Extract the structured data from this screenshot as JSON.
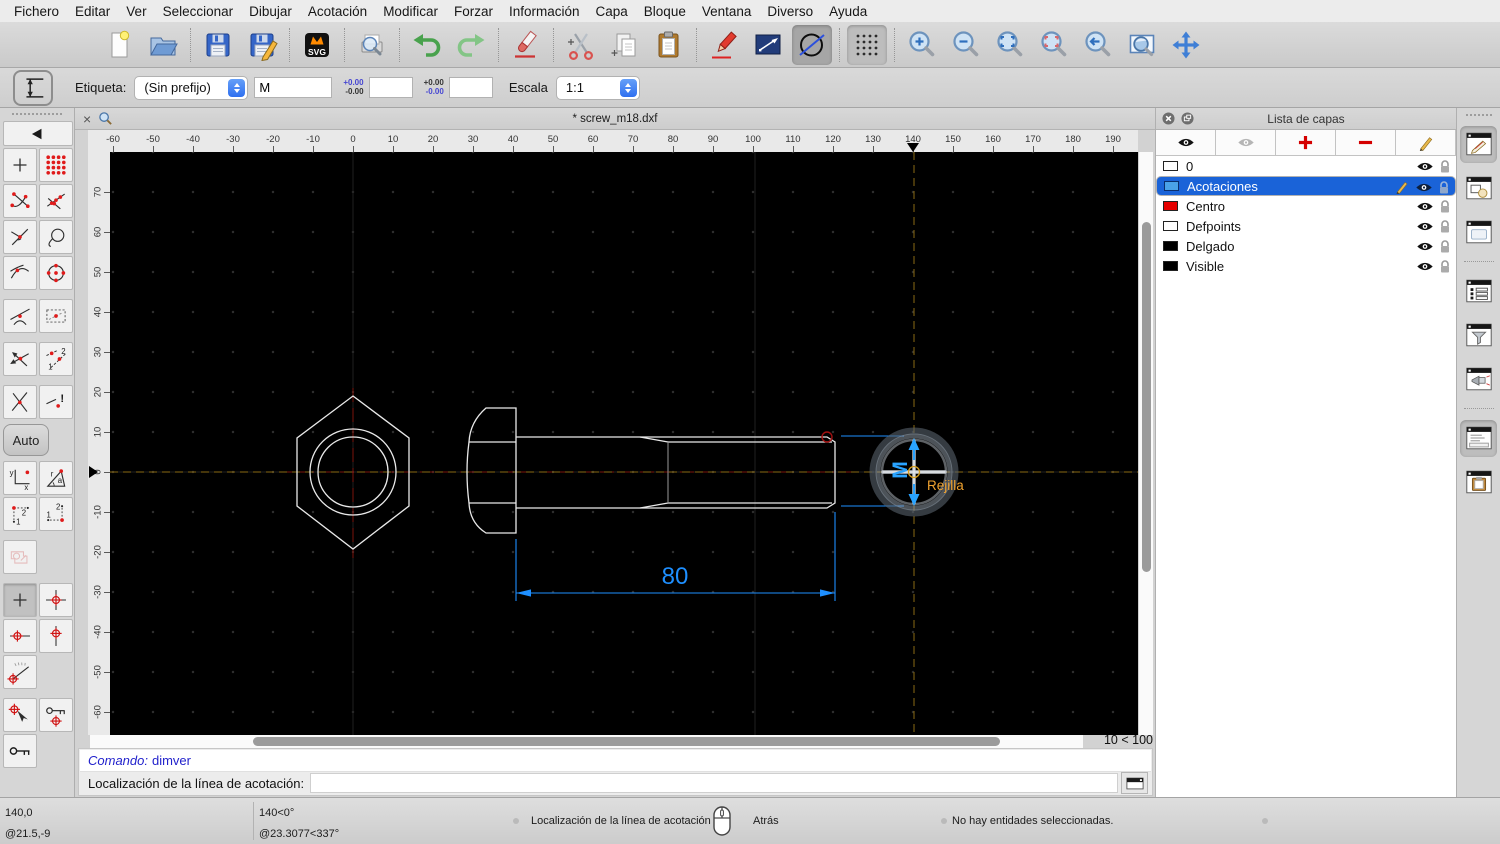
{
  "colors": {
    "selection_blue": "#1a63d8",
    "dimension_blue": "#1e8fff",
    "preview_blue": "#29a3ff",
    "snap_orange": "#f0a22e",
    "centerline_red": "#7d140c",
    "crosshair_gold": "#8a6a14",
    "canvas_black": "#000000"
  },
  "menu_bar": {
    "items": [
      "Fichero",
      "Editar",
      "Ver",
      "Seleccionar",
      "Dibujar",
      "Acotación",
      "Modificar",
      "Forzar",
      "Información",
      "Capa",
      "Bloque",
      "Ventana",
      "Diverso",
      "Ayuda"
    ]
  },
  "main_toolbar": {
    "buttons": [
      {
        "name": "new-document"
      },
      {
        "name": "open-file"
      },
      {
        "separator": true
      },
      {
        "name": "save"
      },
      {
        "name": "save-as"
      },
      {
        "separator": true
      },
      {
        "name": "svg-export"
      },
      {
        "separator": true
      },
      {
        "name": "print-preview"
      },
      {
        "separator": true
      },
      {
        "name": "undo"
      },
      {
        "name": "redo"
      },
      {
        "separator": true
      },
      {
        "name": "delete"
      },
      {
        "separator": true
      },
      {
        "name": "cut"
      },
      {
        "name": "copy"
      },
      {
        "name": "paste"
      },
      {
        "separator": true
      },
      {
        "name": "draw-pencil"
      },
      {
        "name": "polyline-tool"
      },
      {
        "name": "circle-tool",
        "pressed": true,
        "dark": true
      },
      {
        "separator": true
      },
      {
        "name": "grid-toggle",
        "pressed": true
      },
      {
        "separator": true
      },
      {
        "name": "zoom-in"
      },
      {
        "name": "zoom-out"
      },
      {
        "name": "zoom-auto"
      },
      {
        "name": "zoom-selection"
      },
      {
        "name": "zoom-previous"
      },
      {
        "name": "zoom-window"
      },
      {
        "name": "pan"
      }
    ]
  },
  "options_toolbar": {
    "active_tool_icon": "vertical-dimension-icon",
    "label_caption": "Etiqueta:",
    "prefix_value": "(Sin prefijo)",
    "label_value": "M",
    "tolerance_upper": {
      "plus": "+0.00",
      "minus": "-0.00"
    },
    "tolerance_lower": {
      "plus": "+0.00",
      "minus": "-0.00"
    },
    "tolerance_upper_value": "",
    "tolerance_lower_value": "",
    "scale_caption": "Escala",
    "scale_value": "1:1"
  },
  "snap_sidebar": {
    "auto_label": "Auto",
    "rows": [
      {
        "type": "wide",
        "icon": "back-arrow",
        "name": "snap-back"
      },
      {
        "type": "pair",
        "icons": [
          "free-snap",
          "grid-snap"
        ]
      },
      {
        "type": "pair",
        "icons": [
          "endpoint-snap",
          "on-entity-snap"
        ]
      },
      {
        "type": "pair",
        "icons": [
          "perpendicular-snap",
          "reference-snap"
        ]
      },
      {
        "type": "pair",
        "icons": [
          "nearest-snap",
          "center-snap"
        ]
      },
      {
        "type": "gap"
      },
      {
        "type": "pair",
        "icons": [
          "tangent-snap",
          "middle-snap"
        ]
      },
      {
        "type": "gap"
      },
      {
        "type": "pair",
        "icons": [
          "intersection-auto-snap",
          "intersection-manual-snap"
        ]
      },
      {
        "type": "gap"
      },
      {
        "type": "pair",
        "icons": [
          "intersection-snap",
          "restriction-info"
        ]
      },
      {
        "type": "auto"
      },
      {
        "type": "pair",
        "icons": [
          "coordinate-cartesian",
          "coordinate-polar"
        ]
      },
      {
        "type": "pair",
        "icons": [
          "corner-point-12",
          "corner-point-21"
        ]
      },
      {
        "type": "gap"
      },
      {
        "type": "single",
        "icons": [
          "selection-tool-faded"
        ]
      },
      {
        "type": "gap"
      },
      {
        "type": "pair",
        "icons": [
          "restrict-nothing",
          "restrict-orthogonal"
        ],
        "pressed": [
          0
        ]
      },
      {
        "type": "pair",
        "icons": [
          "restrict-horizontal",
          "restrict-vertical"
        ]
      },
      {
        "type": "single",
        "icons": [
          "angle-meter"
        ]
      },
      {
        "type": "gap"
      },
      {
        "type": "pair",
        "icons": [
          "set-relative-zero",
          "lock-relative-zero"
        ]
      },
      {
        "type": "single",
        "icons": [
          "key-lock"
        ]
      }
    ]
  },
  "document": {
    "title": "* screw_m18.dxf",
    "h_ruler": {
      "min": -60,
      "max": 190,
      "step": 10,
      "marker": 140
    },
    "v_ruler": {
      "min": -60,
      "max": 70,
      "step": 10,
      "marker": 0
    },
    "grid_status": "10 < 100",
    "entities": {
      "dimension_label": "80",
      "preview_dimension_label": "M",
      "snap_tooltip": "Rejilla"
    }
  },
  "layer_panel": {
    "title": "Lista de capas",
    "toolbar": [
      {
        "name": "show-all-layers",
        "icon": "eye"
      },
      {
        "name": "hide-all-layers",
        "icon": "eye-gray"
      },
      {
        "name": "add-layer",
        "icon": "plus-red"
      },
      {
        "name": "remove-layer",
        "icon": "minus-red"
      },
      {
        "name": "edit-layer",
        "icon": "pencil"
      }
    ],
    "layers": [
      {
        "name": "0",
        "swatch": "#ffffff",
        "selected": false
      },
      {
        "name": "Acotaciones",
        "swatch": "#4aa2e8",
        "selected": true
      },
      {
        "name": "Centro",
        "swatch": "#e60000",
        "selected": false
      },
      {
        "name": "Defpoints",
        "swatch": "#ffffff",
        "selected": false
      },
      {
        "name": "Delgado",
        "swatch": "#000000",
        "selected": false
      },
      {
        "name": "Visible",
        "swatch": "#000000",
        "selected": false
      }
    ]
  },
  "right_dock": {
    "buttons": [
      {
        "name": "layer-list-panel",
        "active": true
      },
      {
        "name": "block-list-panel"
      },
      {
        "name": "library-browser-panel"
      },
      {
        "separator": true
      },
      {
        "name": "property-list-panel"
      },
      {
        "name": "filter-panel"
      },
      {
        "name": "notification-panel"
      },
      {
        "separator": true
      },
      {
        "name": "command-line-panel",
        "active": true
      },
      {
        "name": "clipboard-panel"
      }
    ]
  },
  "command_panel": {
    "history_label": "Comando:",
    "history_value": "dimver",
    "prompt": "Localización de la línea de acotación:",
    "input_value": ""
  },
  "status_bar": {
    "abs_coord": "140,0",
    "rel_coord": "@21.5,-9",
    "abs_polar": "140<0°",
    "rel_polar": "@23.3077<337°",
    "left_click_action": "Localización de la línea de acotación",
    "right_click_action": "Atrás",
    "selection_status": "No hay entidades seleccionadas."
  }
}
